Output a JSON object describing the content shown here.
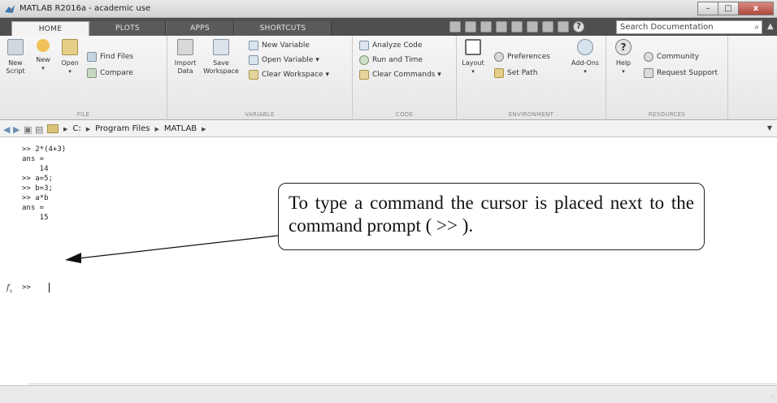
{
  "window": {
    "title": "MATLAB R2016a - academic use",
    "minimize": "–",
    "maximize": "□",
    "close": "x"
  },
  "tabs": [
    {
      "label": "HOME",
      "active": true
    },
    {
      "label": "PLOTS"
    },
    {
      "label": "APPS"
    },
    {
      "label": "SHORTCUTS"
    }
  ],
  "search": {
    "placeholder": "Search Documentation"
  },
  "ribbon": {
    "file": {
      "label": "FILE",
      "new_script": "New\nScript",
      "new": "New",
      "open": "Open",
      "find_files": "Find Files",
      "compare": "Compare"
    },
    "variable": {
      "label": "VARIABLE",
      "import_data": "Import\nData",
      "save_workspace": "Save\nWorkspace",
      "new_variable": "New Variable",
      "open_variable": "Open Variable ▾",
      "clear_workspace": "Clear Workspace ▾"
    },
    "code": {
      "label": "CODE",
      "analyze_code": "Analyze Code",
      "run_and_time": "Run and Time",
      "clear_commands": "Clear Commands ▾"
    },
    "environment": {
      "label": "ENVIRONMENT",
      "layout": "Layout",
      "preferences": "Preferences",
      "set_path": "Set Path",
      "add_ons": "Add-Ons"
    },
    "resources": {
      "label": "RESOURCES",
      "help": "Help",
      "community": "Community",
      "request_support": "Request Support"
    }
  },
  "address": {
    "crumbs": [
      "C:",
      "Program Files",
      "MATLAB"
    ]
  },
  "command_window": {
    "lines": [
      ">> 2*(4+3)",
      "ans =",
      "    14",
      ">> a=5;",
      ">> b=3;",
      ">> a*b",
      "ans =",
      "    15"
    ],
    "prompt": ">>"
  },
  "annotation": {
    "text": "To type a command the cursor is placed next to the command prompt ( >> )."
  },
  "colors": {
    "tabstrip": "#4f4f4f",
    "ribbon": "#efefef",
    "annotation_border": "#222222"
  }
}
